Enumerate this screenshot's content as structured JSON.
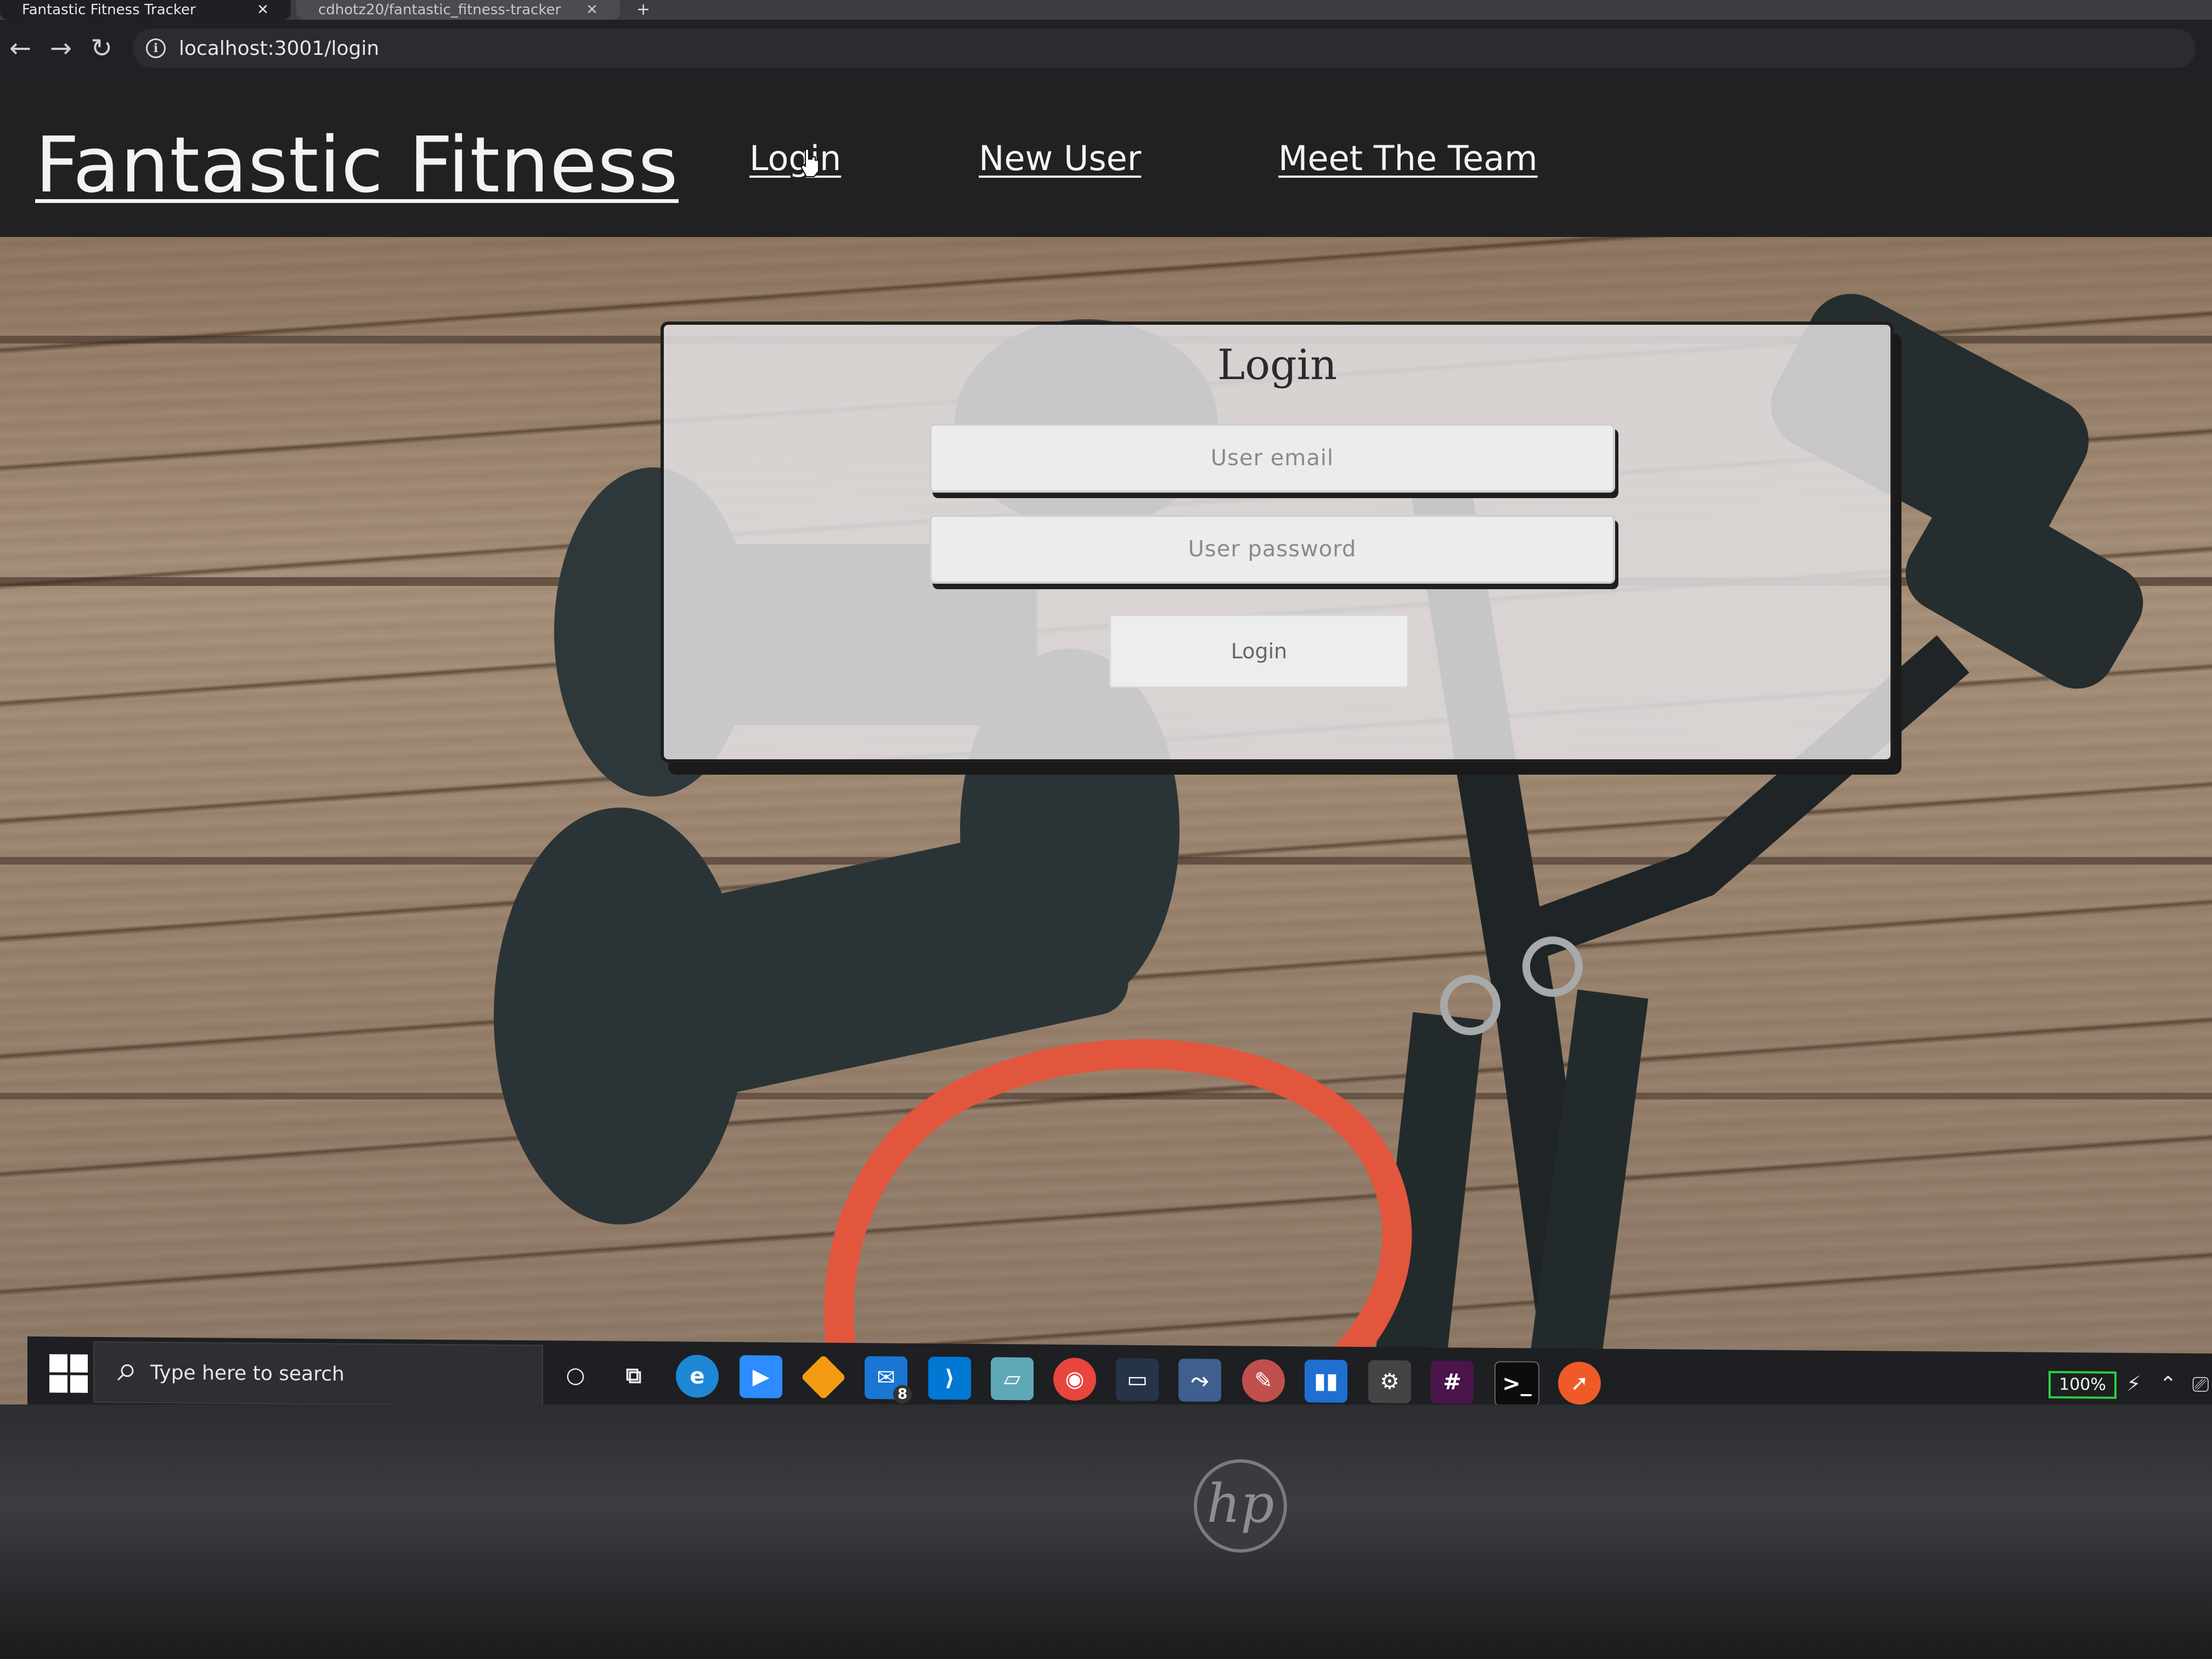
{
  "browser": {
    "active_tab_title": "Fantastic Fitness Tracker",
    "other_tab_title": "cdhotz20/fantastic_fitness-tracker",
    "address": "localhost:3001/login"
  },
  "site": {
    "brand": "Fantastic Fitness",
    "nav": {
      "login": "Login",
      "new_user": "New User",
      "meet_team": "Meet The Team"
    }
  },
  "login_form": {
    "title": "Login",
    "email_placeholder": "User email",
    "password_placeholder": "User password",
    "submit_label": "Login"
  },
  "taskbar": {
    "search_placeholder": "Type here to search",
    "mail_badge": "8",
    "battery": "100%"
  },
  "colors": {
    "header_bg": "#202123",
    "card_bg": "#e2e0e2",
    "band_red": "#e2563d",
    "dumbbell": "#2b3538",
    "battery_green": "#2ecc40"
  }
}
